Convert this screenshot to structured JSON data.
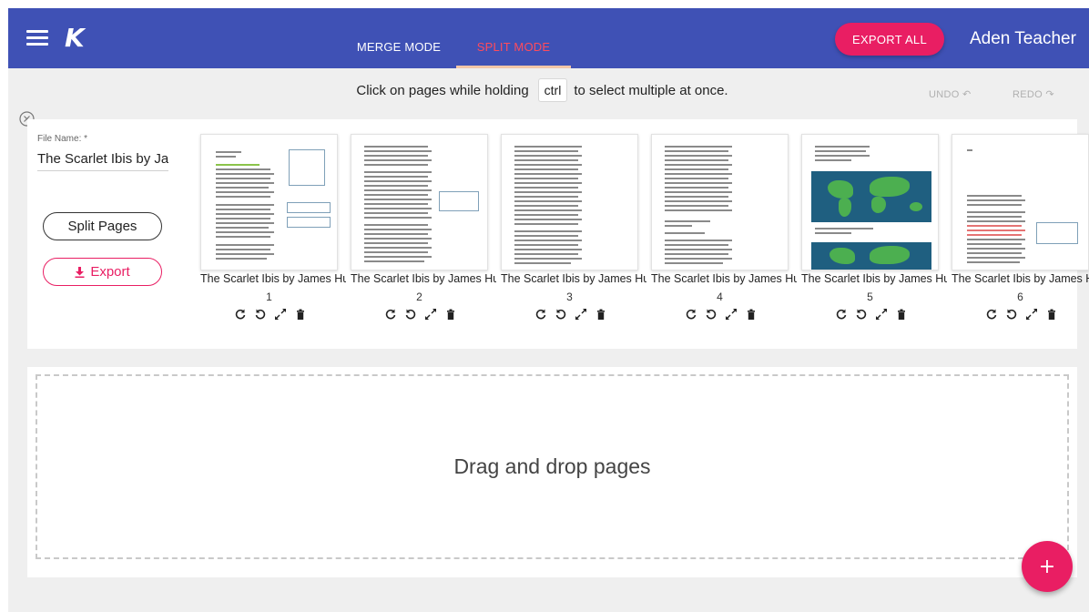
{
  "header": {
    "logo": "K",
    "tabs": [
      {
        "label": "MERGE MODE"
      },
      {
        "label": "SPLIT MODE"
      }
    ],
    "export_all_label": "EXPORT ALL",
    "user_name": "Aden Teacher"
  },
  "toolbar": {
    "hint_pre": "Click on pages while holding",
    "hint_key": "ctrl",
    "hint_post": "to select multiple at once.",
    "undo_label": "UNDO ↶",
    "redo_label": "REDO ↷"
  },
  "file": {
    "label": "File Name: *",
    "value": "The Scarlet Ibis by James Hurst",
    "split_label": "Split Pages",
    "export_label": "Export"
  },
  "pages": [
    {
      "name": "The Scarlet Ibis by James Hurst",
      "number": "1"
    },
    {
      "name": "The Scarlet Ibis by James Hurst",
      "number": "2"
    },
    {
      "name": "The Scarlet Ibis by James Hurst",
      "number": "3"
    },
    {
      "name": "The Scarlet Ibis by James Hurst",
      "number": "4"
    },
    {
      "name": "The Scarlet Ibis by James Hurst",
      "number": "5"
    },
    {
      "name": "The Scarlet Ibis by James Hurst",
      "number": "6"
    }
  ],
  "dropzone": {
    "text": "Drag and drop pages"
  },
  "fab_label": "+",
  "colors": {
    "header_bg": "#3f51b5",
    "accent": "#e91e63",
    "active_tab": "#ff4b5c"
  }
}
